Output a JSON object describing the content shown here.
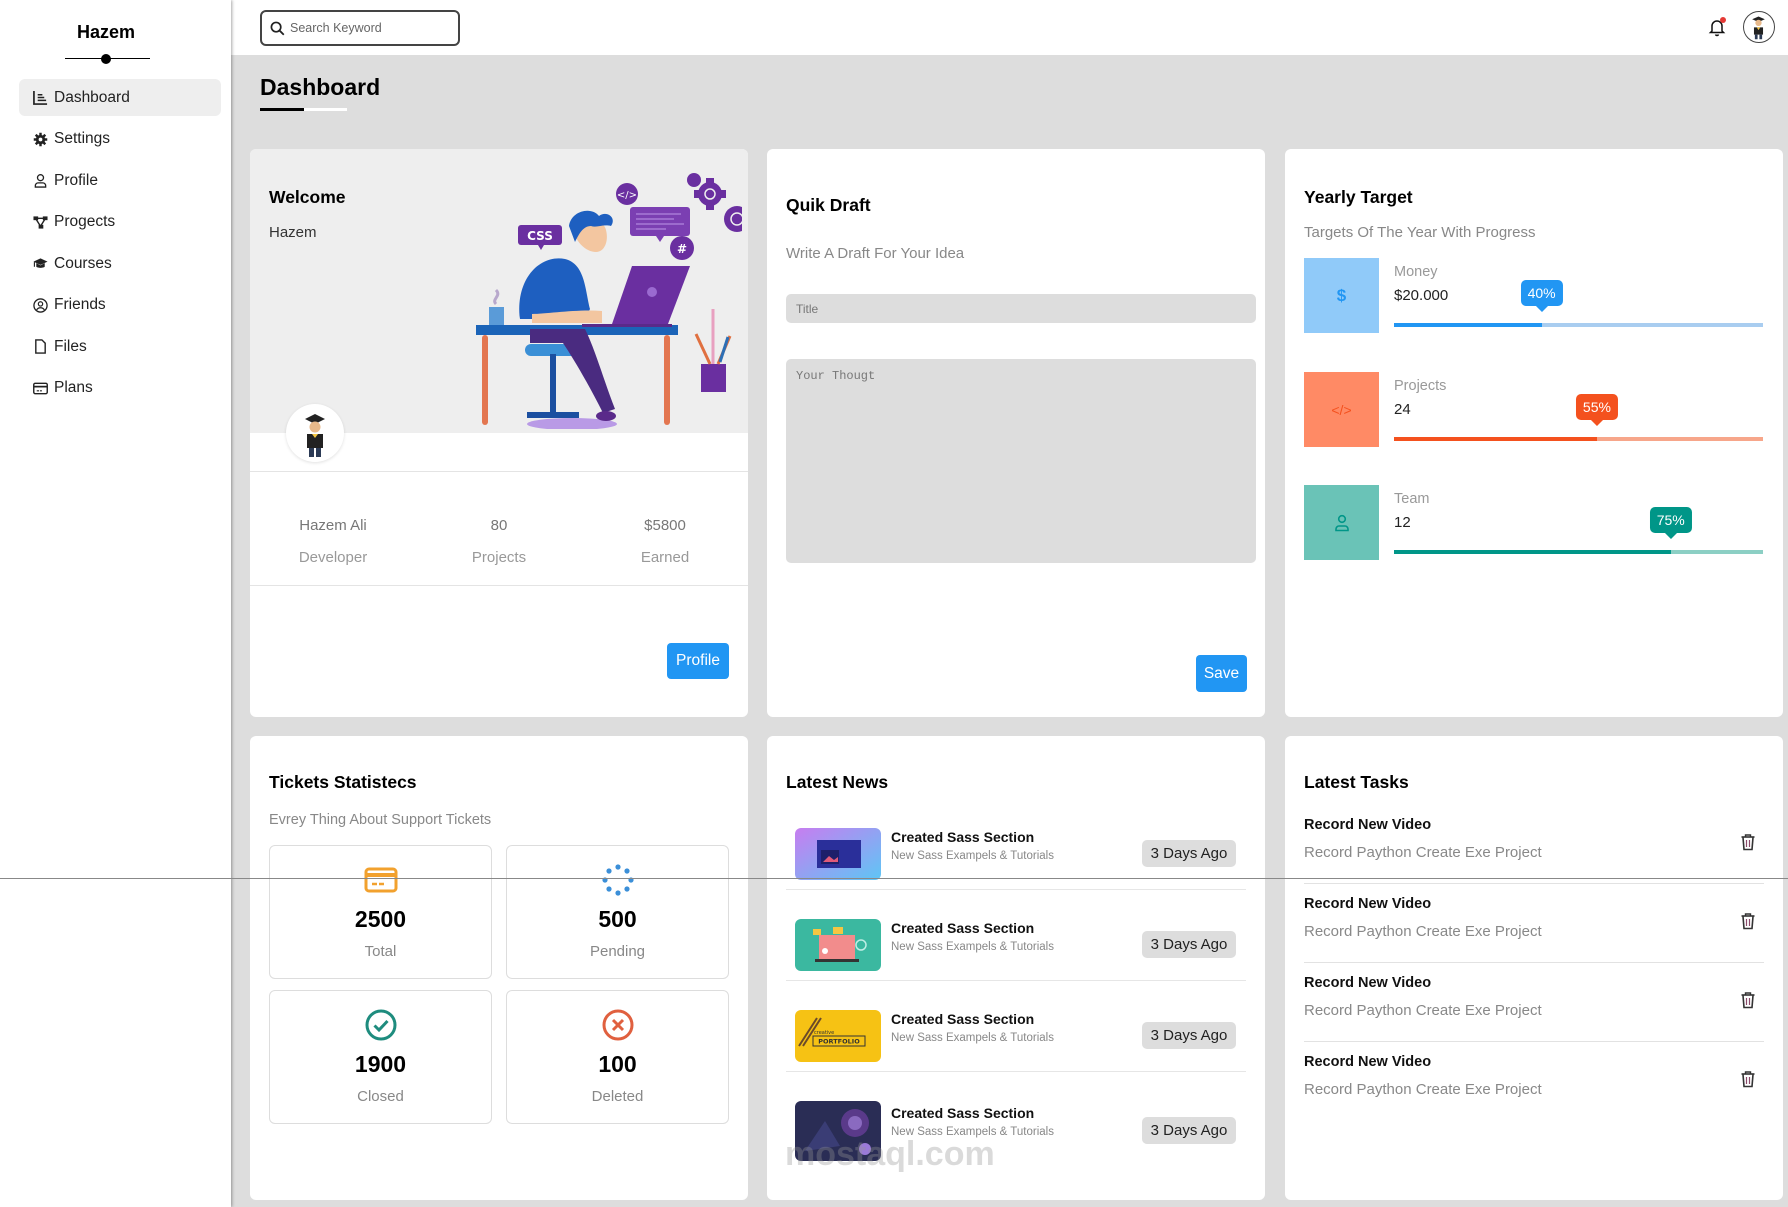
{
  "sidebar": {
    "brand": "Hazem",
    "items": [
      {
        "label": "Dashboard",
        "icon": "chart-icon",
        "active": true
      },
      {
        "label": "Settings",
        "icon": "gear-icon",
        "active": false
      },
      {
        "label": "Profile",
        "icon": "user-icon",
        "active": false
      },
      {
        "label": "Progects",
        "icon": "diagram-icon",
        "active": false
      },
      {
        "label": "Courses",
        "icon": "graduation-cap-icon",
        "active": false
      },
      {
        "label": "Friends",
        "icon": "user-circle-icon",
        "active": false
      },
      {
        "label": "Files",
        "icon": "file-icon",
        "active": false
      },
      {
        "label": "Plans",
        "icon": "credit-card-icon",
        "active": false
      }
    ]
  },
  "topbar": {
    "search_placeholder": "Search Keyword",
    "notification_icon": "bell-icon",
    "avatar": "user-avatar"
  },
  "page": {
    "title": "Dashboard"
  },
  "welcome": {
    "title": "Welcome",
    "name": "Hazem",
    "stats": [
      {
        "value": "Hazem Ali",
        "label": "Developer"
      },
      {
        "value": "80",
        "label": "Projects"
      },
      {
        "value": "$5800",
        "label": "Earned"
      }
    ],
    "button": "Profile"
  },
  "draft": {
    "title": "Quik Draft",
    "subtitle": "Write A Draft For Your Idea",
    "title_placeholder": "Title",
    "text_placeholder": "Your Thougt",
    "button": "Save"
  },
  "targets": {
    "title": "Yearly Target",
    "subtitle": "Targets Of The Year With Progress",
    "items": [
      {
        "label": "Money",
        "value": "$20.000",
        "percent": 40,
        "percent_label": "40%",
        "icon": "dollar-icon",
        "icon_glyph": "$",
        "color": "#2196f3",
        "bg": "#90caf9",
        "track": "#a9cdf0"
      },
      {
        "label": "Projects",
        "value": "24",
        "percent": 55,
        "percent_label": "55%",
        "icon": "code-icon",
        "icon_glyph": "</>",
        "color": "#f4511e",
        "bg": "#ff8a65",
        "track": "#f7a68a"
      },
      {
        "label": "Team",
        "value": "12",
        "percent": 75,
        "percent_label": "75%",
        "icon": "user-icon",
        "icon_glyph": "",
        "color": "#009688",
        "bg": "#6ac3b7",
        "track": "#8ccfc4"
      }
    ]
  },
  "tickets": {
    "title": "Tickets Statistecs",
    "subtitle": "Evrey Thing About Support Tickets",
    "items": [
      {
        "value": "2500",
        "label": "Total",
        "icon": "credit-card-icon",
        "color": "#f2a12e"
      },
      {
        "value": "500",
        "label": "Pending",
        "icon": "spinner-icon",
        "color": "#3b8fd8"
      },
      {
        "value": "1900",
        "label": "Closed",
        "icon": "check-circle-icon",
        "color": "#1e8c7e"
      },
      {
        "value": "100",
        "label": "Deleted",
        "icon": "x-circle-icon",
        "color": "#e0603f"
      }
    ]
  },
  "news": {
    "title": "Latest News",
    "items": [
      {
        "title": "Created Sass Section",
        "desc": "New Sass Exampels & Tutorials",
        "time": "3 Days Ago",
        "thumb": "web-design-thumbnail"
      },
      {
        "title": "Created Sass Section",
        "desc": "New Sass Exampels & Tutorials",
        "time": "3 Days Ago",
        "thumb": "marketing-thumbnail"
      },
      {
        "title": "Created Sass Section",
        "desc": "New Sass Exampels & Tutorials",
        "time": "3 Days Ago",
        "thumb": "portfolio-thumbnail",
        "thumb_text_small": "creative",
        "thumb_text": "PORTFOLIO"
      },
      {
        "title": "Created Sass Section",
        "desc": "New Sass Exampels & Tutorials",
        "time": "3 Days Ago",
        "thumb": "fantasy-art-thumbnail"
      }
    ]
  },
  "tasks": {
    "title": "Latest Tasks",
    "items": [
      {
        "title": "Record New Video",
        "desc": "Record Paython Create Exe Project"
      },
      {
        "title": "Record New Video",
        "desc": "Record Paython Create Exe Project"
      },
      {
        "title": "Record New Video",
        "desc": "Record Paython Create Exe Project"
      },
      {
        "title": "Record New Video",
        "desc": "Record Paython Create Exe Project"
      }
    ]
  },
  "watermark": "mostaql.com"
}
